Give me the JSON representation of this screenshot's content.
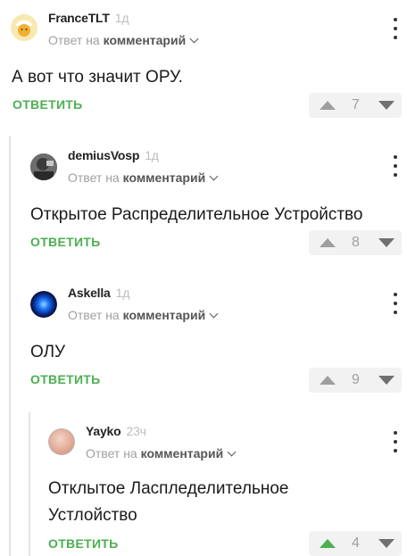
{
  "common": {
    "reply_to_prefix": "Ответ на",
    "reply_to_link": "комментарий",
    "reply_button": "ОТВЕТИТЬ"
  },
  "comments": [
    {
      "author": "FranceTLT",
      "time": "1д",
      "text": "А вот что значит ОРУ.",
      "score": "7"
    },
    {
      "author": "demiusVosp",
      "time": "1д",
      "text": "Открытое Распределительное Устройство",
      "score": "8"
    },
    {
      "author": "Askella",
      "time": "1д",
      "text": "ОЛУ",
      "score": "9"
    },
    {
      "author": "Yayko",
      "time": "23ч",
      "text": "Отклытое Ласпледелительное Устлойство",
      "score": "4"
    }
  ],
  "colors": {
    "accent": "#4caf50",
    "muted": "#a0a0a0"
  },
  "icons": {
    "menu": "more-vertical-icon",
    "upvote": "arrow-up-icon",
    "downvote": "arrow-down-icon"
  }
}
